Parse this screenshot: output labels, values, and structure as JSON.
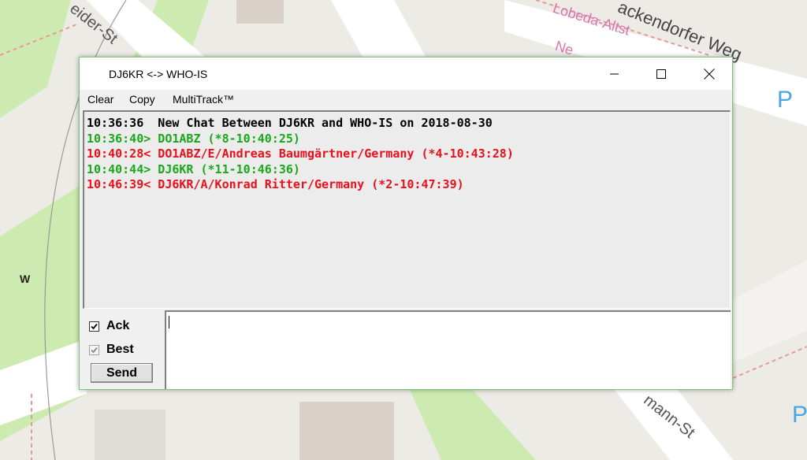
{
  "window": {
    "title": "DJ6KR <-> WHO-IS",
    "border_color": "#7cc576"
  },
  "menu": {
    "items": [
      "Clear",
      "Copy",
      "MultiTrack™"
    ]
  },
  "chat": {
    "lines": [
      {
        "text": "10:36:36  New Chat Between DJ6KR and WHO-IS on 2018-08-30",
        "color": "#000000"
      },
      {
        "text": "10:36:40> DO1ABZ (*8-10:40:25)",
        "color": "#1aa81a"
      },
      {
        "text": "10:40:28< DO1ABZ/E/Andreas Baumgärtner/Germany (*4-10:43:28)",
        "color": "#e8101a"
      },
      {
        "text": "10:40:44> DJ6KR (*11-10:46:36)",
        "color": "#1aa81a"
      },
      {
        "text": "10:46:39< DJ6KR/A/Konrad Ritter/Germany (*2-10:47:39)",
        "color": "#e8101a"
      }
    ]
  },
  "controls": {
    "ack_label": "Ack",
    "ack_checked": true,
    "best_label": "Best",
    "best_checked": true,
    "send_label": "Send",
    "message_value": ""
  },
  "map": {
    "labels": [
      "W",
      "Lobeda-Altst",
      "ackendorfer Weg",
      "eider-St",
      "mann-St",
      "P",
      "P",
      "Ne"
    ]
  }
}
